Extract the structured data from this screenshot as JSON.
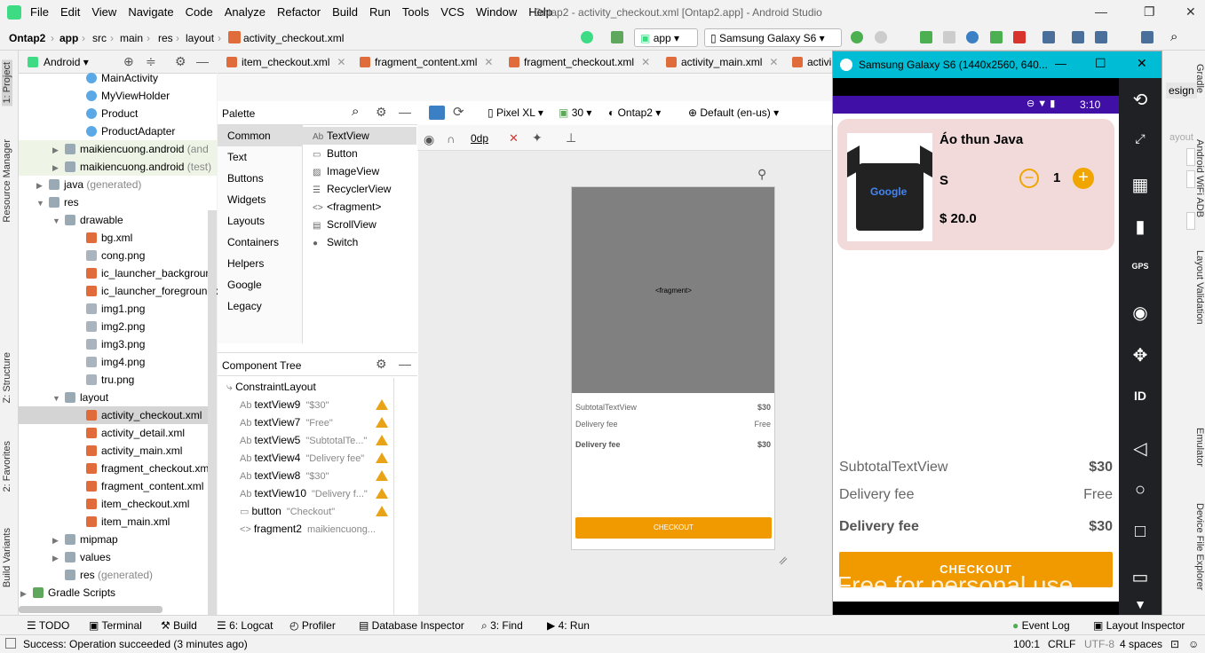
{
  "menu": {
    "items": [
      "File",
      "Edit",
      "View",
      "Navigate",
      "Code",
      "Analyze",
      "Refactor",
      "Build",
      "Run",
      "Tools",
      "VCS",
      "Window",
      "Help"
    ],
    "window_title": "Ontap2 - activity_checkout.xml [Ontap2.app] - Android Studio"
  },
  "breadcrumb": {
    "project": "Ontap2",
    "module": "app",
    "p1": "src",
    "p2": "main",
    "p3": "res",
    "p4": "layout",
    "file": "activity_checkout.xml"
  },
  "toolbar": {
    "run_config": "app",
    "device": "Samsung Galaxy S6"
  },
  "project_panel": {
    "view_mode": "Android",
    "tab_label": "1: Project",
    "items": [
      {
        "label": "MainActivity",
        "type": "class"
      },
      {
        "label": "MyViewHolder",
        "type": "class"
      },
      {
        "label": "Product",
        "type": "class"
      },
      {
        "label": "ProductAdapter",
        "type": "class"
      },
      {
        "label": "maikiencuong.android",
        "suffix": "(and",
        "type": "folder"
      },
      {
        "label": "maikiencuong.android",
        "suffix": "(test)",
        "type": "folder"
      },
      {
        "label": "java",
        "suffix": "(generated)",
        "type": "folder"
      },
      {
        "label": "res",
        "type": "folder"
      },
      {
        "label": "drawable",
        "type": "folder"
      },
      {
        "label": "bg.xml",
        "type": "xml"
      },
      {
        "label": "cong.png",
        "type": "png"
      },
      {
        "label": "ic_launcher_background",
        "type": "xml"
      },
      {
        "label": "ic_launcher_foreground.x",
        "type": "xml"
      },
      {
        "label": "img1.png",
        "type": "png"
      },
      {
        "label": "img2.png",
        "type": "png"
      },
      {
        "label": "img3.png",
        "type": "png"
      },
      {
        "label": "img4.png",
        "type": "png"
      },
      {
        "label": "tru.png",
        "type": "png"
      },
      {
        "label": "layout",
        "type": "folder"
      },
      {
        "label": "activity_checkout.xml",
        "type": "xml"
      },
      {
        "label": "activity_detail.xml",
        "type": "xml"
      },
      {
        "label": "activity_main.xml",
        "type": "xml"
      },
      {
        "label": "fragment_checkout.xml",
        "type": "xml"
      },
      {
        "label": "fragment_content.xml",
        "type": "xml"
      },
      {
        "label": "item_checkout.xml",
        "type": "xml"
      },
      {
        "label": "item_main.xml",
        "type": "xml"
      },
      {
        "label": "mipmap",
        "type": "folder"
      },
      {
        "label": "values",
        "type": "folder"
      },
      {
        "label": "res",
        "suffix": "(generated)",
        "type": "folder"
      },
      {
        "label": "Gradle Scripts",
        "type": "folder"
      }
    ]
  },
  "left_strip": {
    "resource_manager": "Resource Manager",
    "structure": "Z: Structure",
    "favorites": "2: Favorites",
    "build_variants": "Build Variants"
  },
  "editor_tabs": [
    "item_checkout.xml",
    "fragment_content.xml",
    "fragment_checkout.xml",
    "activity_main.xml",
    "activi"
  ],
  "designer": {
    "palette_title": "Palette",
    "categories": [
      "Common",
      "Text",
      "Buttons",
      "Widgets",
      "Layouts",
      "Containers",
      "Helpers",
      "Google",
      "Legacy"
    ],
    "widgets": [
      "TextView",
      "Button",
      "ImageView",
      "RecyclerView",
      "<fragment>",
      "ScrollView",
      "Switch"
    ],
    "device": "Pixel XL",
    "api": "30",
    "theme": "Ontap2",
    "locale": "Default (en-us)",
    "margin": "0dp",
    "component_tree_title": "Component Tree",
    "tree": [
      {
        "name": "ConstraintLayout",
        "text": ""
      },
      {
        "name": "textView9",
        "text": "\"$30\""
      },
      {
        "name": "textView7",
        "text": "\"Free\""
      },
      {
        "name": "textView5",
        "text": "\"SubtotalTe...\""
      },
      {
        "name": "textView4",
        "text": "\"Delivery fee\""
      },
      {
        "name": "textView8",
        "text": "\"$30\""
      },
      {
        "name": "textView10",
        "text": "\"Delivery f...\""
      },
      {
        "name": "button",
        "text": "\"Checkout\""
      },
      {
        "name": "fragment2",
        "text": "maikiencuong..."
      }
    ],
    "preview": {
      "fragment_label": "<fragment>",
      "subtotal_label": "SubtotalTextView",
      "subtotal_value": "$30",
      "delivery_label": "Delivery fee",
      "delivery_value": "Free",
      "delivery2_label": "Delivery fee",
      "delivery2_value": "$30",
      "button": "CHECKOUT"
    }
  },
  "emulator": {
    "title": "Samsung Galaxy S6 (1440x2560, 640...",
    "time": "3:10",
    "product_name": "Áo thun Java",
    "size": "S",
    "quantity": "1",
    "price": "$ 20.0",
    "shirt_logo": "Google",
    "subtotal_label": "SubtotalTextView",
    "subtotal_value": "$30",
    "delivery_label": "Delivery fee",
    "delivery_value": "Free",
    "delivery2_label": "Delivery fee",
    "delivery2_value": "$30",
    "button": "CHECKOUT",
    "watermark": "Free for personal use",
    "gps": "GPS",
    "id": "ID"
  },
  "right_strip": {
    "gradle": "Gradle",
    "adb": "Android WiFi ADB",
    "layout_validation": "Layout Validation",
    "emulator": "Emulator",
    "device_file": "Device File Explorer",
    "design": "esign",
    "layout": "ayout"
  },
  "bottom_tabs": {
    "todo": "TODO",
    "terminal": "Terminal",
    "build": "Build",
    "logcat": "6: Logcat",
    "profiler": "Profiler",
    "db": "Database Inspector",
    "find": "3: Find",
    "run": "4: Run",
    "event_log": "Event Log",
    "layout_inspector": "Layout Inspector"
  },
  "status": {
    "message": "Success: Operation succeeded (3 minutes ago)",
    "position": "100:1",
    "line_sep": "CRLF",
    "encoding": "UTF-8",
    "indent": "4 spaces"
  }
}
